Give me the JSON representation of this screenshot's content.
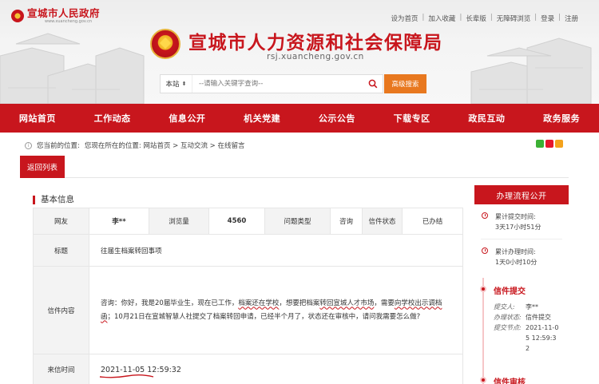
{
  "gov_logo": {
    "name": "宣城市人民政府",
    "domain": "www.xuancheng.gov.cn"
  },
  "top_links": [
    "设为首页",
    "加入收藏",
    "长辈版",
    "无障碍浏览",
    "登录",
    "注册"
  ],
  "site": {
    "title": "宣城市人力资源和社会保障局",
    "domain": "rsj.xuancheng.gov.cn"
  },
  "search": {
    "scope": "本站",
    "placeholder": "--请输入关键字查询--",
    "advanced_label": "高级搜索"
  },
  "nav": [
    "网站首页",
    "工作动态",
    "信息公开",
    "机关党建",
    "公示公告",
    "下载专区",
    "政民互动",
    "政务服务"
  ],
  "breadcrumb": {
    "prefix": "您当前的位置:",
    "path": "您现在所在的位置:  网站首页 > 互动交流 > 在线留言"
  },
  "back_label": "返回列表",
  "basic": {
    "section_title": "基本信息",
    "labels": {
      "user": "网友",
      "views": "浏览量",
      "type": "问题类型",
      "status": "信件状态",
      "title": "标题",
      "content": "信件内容",
      "time": "来信时间"
    },
    "user": "李**",
    "views": "4560",
    "type": "咨询",
    "status": "已办结",
    "title": "往届生档案转回事项",
    "content": {
      "p1": "咨询：你好，我是20届毕业生，现在已工作，",
      "h1": "档案还在学校",
      "p2": "，想要把档案",
      "h2": "转回宣城人才市场",
      "p3": "，需要",
      "h3": "向学校出示调档函",
      "p4": "；10月21日在宣城智慧人社提交了档案转回申请，已经半个月了，状态还在审核中，请问我需要怎么做?"
    },
    "time": "2021-11-05 12:59:32"
  },
  "side": {
    "title": "办理流程公开",
    "total_submit_label": "累计提交时间:",
    "total_submit_value": "3天17小时51分",
    "total_handle_label": "累计办理时间:",
    "total_handle_value": "1天0小时10分",
    "step1": "信件提交",
    "submitter_label": "提交人:",
    "submitter": "李**",
    "handle_status_label": "办理状态:",
    "handle_status": "信件提交",
    "submit_time_label": "提交节点:",
    "submit_time": "2021-11-05 12:59:32",
    "step2": "信件审核"
  },
  "colors": {
    "brand_red": "#c8161d",
    "search_orange": "#e8781f"
  }
}
